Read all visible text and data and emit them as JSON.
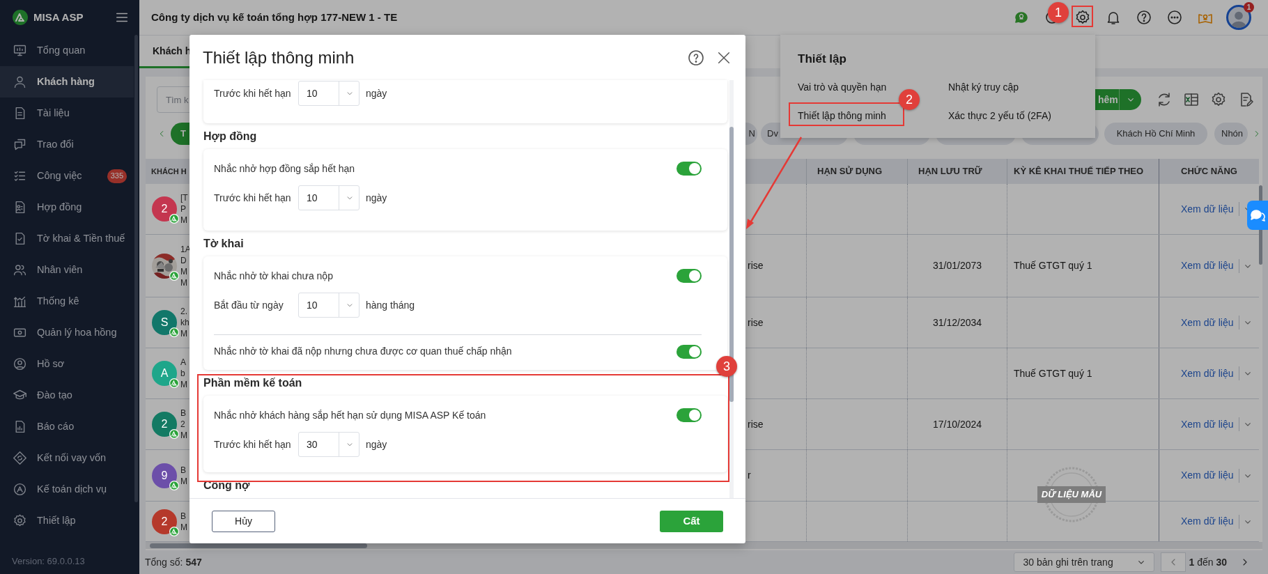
{
  "sidebar": {
    "logo": "MISA ASP",
    "items": [
      {
        "label": "Tổng quan",
        "selected": false
      },
      {
        "label": "Khách hàng",
        "selected": true
      },
      {
        "label": "Tài liệu",
        "selected": false
      },
      {
        "label": "Trao đổi",
        "selected": false
      },
      {
        "label": "Công việc",
        "selected": false,
        "badge": "335"
      },
      {
        "label": "Hợp đồng",
        "selected": false
      },
      {
        "label": "Tờ khai & Tiền thuế",
        "selected": false
      },
      {
        "label": "Nhân viên",
        "selected": false
      },
      {
        "label": "Thống kê",
        "selected": false
      },
      {
        "label": "Quản lý hoa hồng",
        "selected": false
      },
      {
        "label": "Hồ sơ",
        "selected": false
      },
      {
        "label": "Đào tạo",
        "selected": false
      },
      {
        "label": "Báo cáo",
        "selected": false
      },
      {
        "label": "Kết nối vay vốn",
        "selected": false
      },
      {
        "label": "Kế toán dịch vụ",
        "selected": false
      },
      {
        "label": "Thiết lập",
        "selected": false
      }
    ],
    "version": "Version: 69.0.0.13"
  },
  "header": {
    "company": "Công ty dịch vụ kế toán tổng hợp 177-NEW 1 - TE",
    "avatar_badge": "1"
  },
  "tabs": [
    {
      "label": "Khách h",
      "selected": true
    }
  ],
  "search": {
    "placeholder": "Tìm k"
  },
  "add_button": "hêm",
  "filter_chips": [
    {
      "label": "T",
      "selected": true
    },
    {
      "label": "N",
      "selected": false
    },
    {
      "label": "Dv",
      "selected": false
    },
    {
      "selected": false
    },
    {
      "selected": false
    },
    {
      "selected": false
    },
    {
      "label": "Khách Hồ Chí Minh",
      "selected": false
    },
    {
      "label": "Nhón",
      "selected": false
    }
  ],
  "table": {
    "columns": [
      "KHÁCH H",
      "HẠN SỬ DỤNG",
      "HẠN LƯU TRỮ",
      "KỲ KÊ KHAI THUẾ TIẾP THEO",
      "CHỨC NĂNG"
    ],
    "rows": [
      {
        "avatar": {
          "kind": "letter",
          "text": "2",
          "color": "#c4364f"
        },
        "lines": [
          "[T",
          "P",
          "M"
        ],
        "action": "Xem dữ liệu"
      },
      {
        "avatar": {
          "kind": "picture"
        },
        "lines": [
          "1A",
          "D",
          "M",
          "M"
        ],
        "plan": "rise",
        "storage": "31/01/2073",
        "tax": "Thuế GTGT quý 1",
        "action": "Xem dữ liệu"
      },
      {
        "avatar": {
          "kind": "letter",
          "text": "S",
          "color": "#12776a"
        },
        "lines": [
          "2.",
          "kh",
          "M"
        ],
        "plan": "rise",
        "storage": "31/12/2034",
        "action": "Xem dữ liệu"
      },
      {
        "avatar": {
          "kind": "letter",
          "text": "A",
          "color": "#1ea68a"
        },
        "lines": [
          "A",
          "b",
          "M"
        ],
        "tax": "Thuế GTGT quý 1",
        "action": "Xem dữ liệu"
      },
      {
        "avatar": {
          "kind": "letter",
          "text": "2",
          "color": "#137a63"
        },
        "lines": [
          "B",
          "2",
          "M"
        ],
        "plan": "rise",
        "storage": "17/10/2024",
        "action": "Xem dữ liệu"
      },
      {
        "avatar": {
          "kind": "letter",
          "text": "9",
          "color": "#6c4fa9"
        },
        "lines": [
          "B",
          "M"
        ],
        "plan": "r",
        "action": "Xem dữ liệu"
      },
      {
        "avatar": {
          "kind": "letter",
          "text": "2",
          "color": "#b5392b"
        },
        "lines": [
          "B",
          "M"
        ],
        "action": "Xem dữ liệu"
      }
    ]
  },
  "stamp": "DỮ LIỆU MẪU",
  "footer": {
    "total": "Tổng số: **547**",
    "page_size": "30 bản ghi trên trang",
    "range": "**1** đến **30**"
  },
  "settings_menu": {
    "title": "Thiết lập",
    "items": [
      "Vai trò và quyền hạn",
      "Nhật ký truy cập",
      "Thiết lập thông minh",
      "Xác thực 2 yếu tố (2FA)"
    ]
  },
  "modal": {
    "title": "Thiết lập thông minh",
    "sections": [
      {
        "rows": [
          {
            "kind": "select",
            "label": "Trước khi hết hạn",
            "value": "10",
            "unit": "ngày"
          }
        ]
      },
      {
        "title": "Hợp đồng",
        "rows": [
          {
            "kind": "toggle",
            "label": "Nhắc nhở hợp đồng sắp hết hạn",
            "on": true
          },
          {
            "kind": "select",
            "label": "Trước khi hết hạn",
            "value": "10",
            "unit": "ngày"
          }
        ]
      },
      {
        "title": "Tờ khai",
        "rows": [
          {
            "kind": "toggle",
            "label": "Nhắc nhở tờ khai chưa nộp",
            "on": true
          },
          {
            "kind": "select",
            "label": "Bắt đầu từ ngày",
            "value": "10",
            "unit": "hàng tháng"
          },
          {
            "kind": "toggle",
            "label": "Nhắc nhở tờ khai đã nộp nhưng chưa được cơ quan thuế chấp nhận",
            "on": true
          }
        ]
      },
      {
        "title": "Phần mềm kế toán",
        "rows": [
          {
            "kind": "toggle",
            "label": "Nhắc nhở khách hàng sắp hết hạn sử dụng MISA ASP Kế toán",
            "on": true
          },
          {
            "kind": "select",
            "label": "Trước khi hết hạn",
            "value": "30",
            "unit": "ngày"
          }
        ]
      },
      {
        "title": "Công nợ"
      }
    ],
    "cancel": "Hủy",
    "save": "Cất"
  },
  "annotations": [
    {
      "number": "1"
    },
    {
      "number": "2"
    },
    {
      "number": "3"
    }
  ]
}
